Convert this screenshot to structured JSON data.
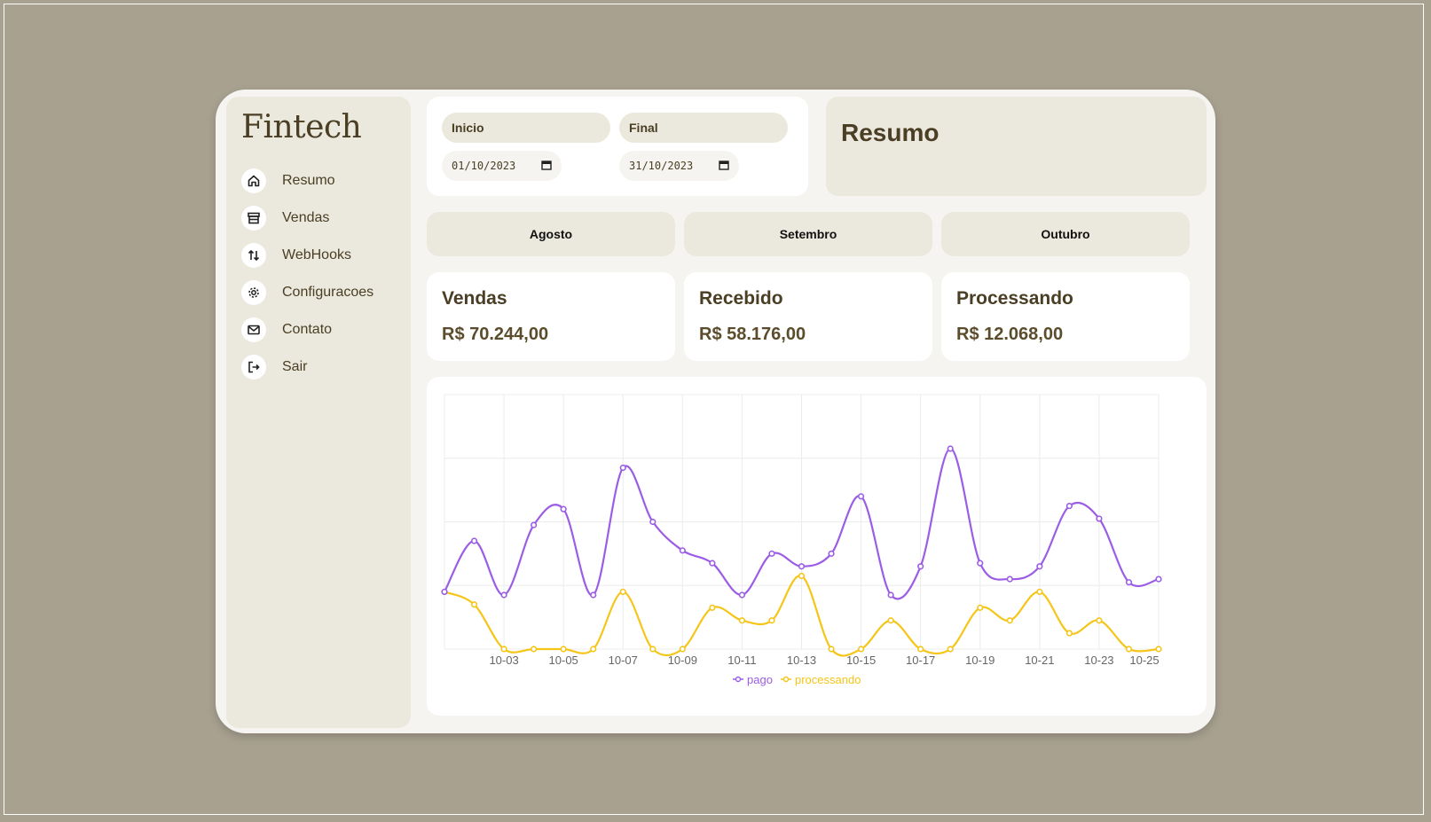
{
  "app": {
    "logo": "Fintech"
  },
  "sidebar": {
    "items": [
      {
        "label": "Resumo",
        "icon": "home-icon"
      },
      {
        "label": "Vendas",
        "icon": "store-icon"
      },
      {
        "label": "WebHooks",
        "icon": "arrows-updown-icon"
      },
      {
        "label": "Configuracoes",
        "icon": "gear-icon"
      },
      {
        "label": "Contato",
        "icon": "mail-icon"
      },
      {
        "label": "Sair",
        "icon": "logout-icon"
      }
    ]
  },
  "filters": {
    "start_label": "Inicio",
    "start_value": "01/10/2023",
    "end_label": "Final",
    "end_value": "31/10/2023"
  },
  "summary": {
    "title": "Resumo"
  },
  "months": [
    "Agosto",
    "Setembro",
    "Outubro"
  ],
  "stats": [
    {
      "title": "Vendas",
      "value": "R$ 70.244,00"
    },
    {
      "title": "Recebido",
      "value": "R$ 58.176,00"
    },
    {
      "title": "Processando",
      "value": "R$ 12.068,00"
    }
  ],
  "colors": {
    "pago": "#9b5de5",
    "processando": "#f5c518",
    "text": "#4a3e24"
  },
  "chart_data": {
    "type": "line",
    "categories": [
      "10-01",
      "10-02",
      "10-03",
      "10-04",
      "10-05",
      "10-06",
      "10-07",
      "10-08",
      "10-09",
      "10-10",
      "10-11",
      "10-12",
      "10-13",
      "10-14",
      "10-15",
      "10-16",
      "10-17",
      "10-18",
      "10-19",
      "10-20",
      "10-21",
      "10-22",
      "10-23",
      "10-24",
      "10-25"
    ],
    "tick_labels": [
      "10-03",
      "10-05",
      "10-07",
      "10-09",
      "10-11",
      "10-13",
      "10-15",
      "10-17",
      "10-19",
      "10-21",
      "10-23",
      "10-25"
    ],
    "series": [
      {
        "name": "pago",
        "values": [
          900,
          1700,
          850,
          1950,
          2200,
          850,
          2850,
          2000,
          1550,
          1350,
          850,
          1500,
          1300,
          1500,
          2400,
          850,
          1300,
          3150,
          1350,
          1100,
          1300,
          2250,
          2050,
          1050,
          1100
        ]
      },
      {
        "name": "processando",
        "values": [
          900,
          700,
          0,
          0,
          0,
          0,
          900,
          0,
          0,
          650,
          450,
          450,
          1150,
          0,
          0,
          450,
          0,
          0,
          650,
          450,
          900,
          250,
          450,
          0,
          0
        ]
      }
    ],
    "ylim": [
      0,
      4000
    ],
    "grid": true,
    "legend": "bottom"
  }
}
